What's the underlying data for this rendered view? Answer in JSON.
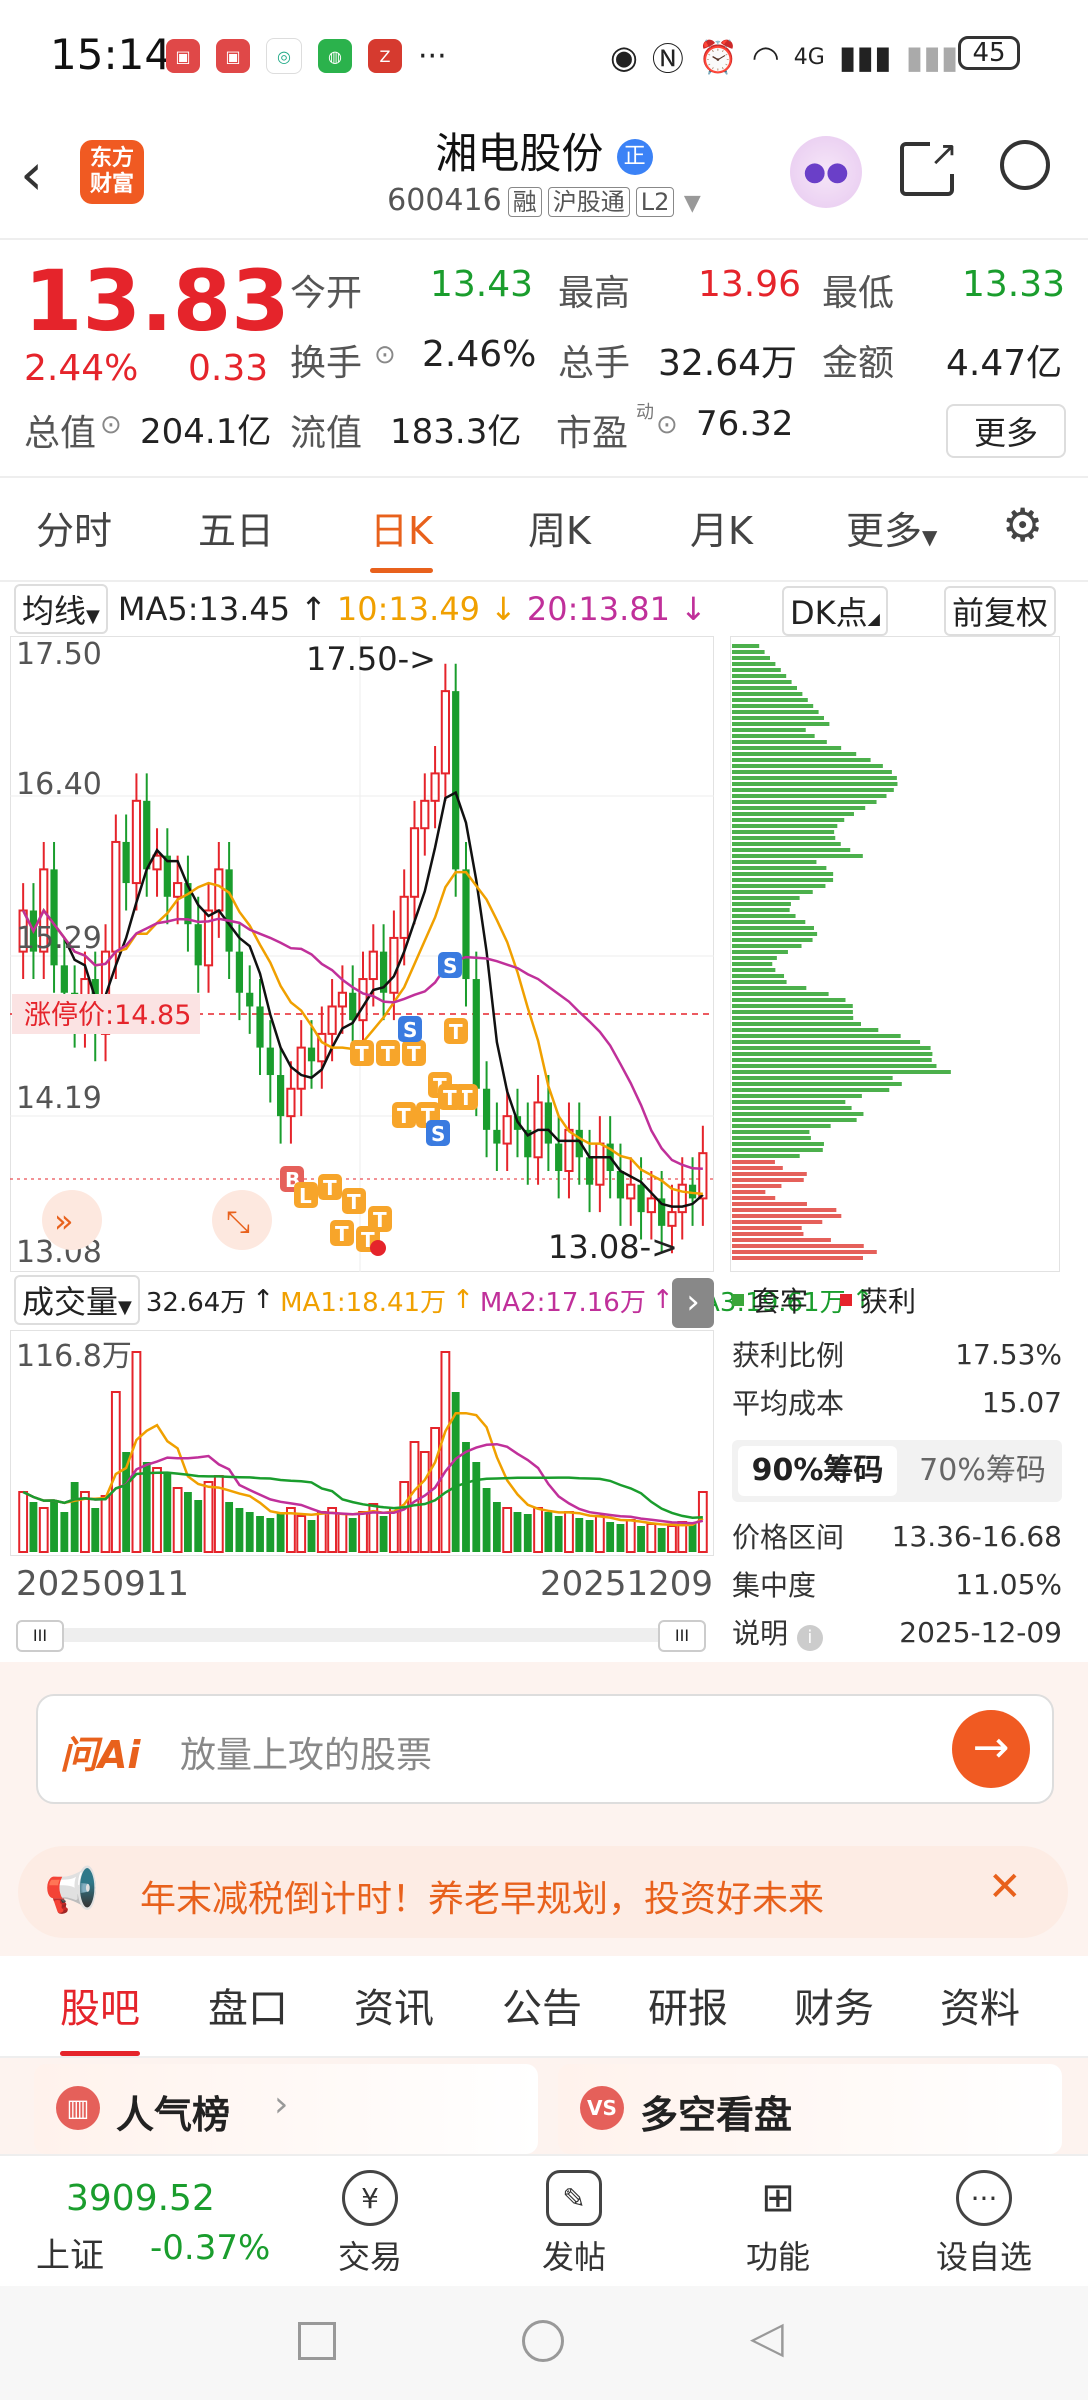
{
  "status_bar": {
    "time": "15:14",
    "notif_icons": [
      "huawei-app-icon",
      "huawei-app-icon",
      "browser-icon",
      "wechat-icon",
      "app-icon",
      "more-dots"
    ],
    "battery": "45",
    "network": "4G"
  },
  "header": {
    "logo_line1": "东方",
    "logo_line2": "财富",
    "stock_name": "湘电股份",
    "stock_badge": "正",
    "code": "600416",
    "tag_rong": "融",
    "tag_hgt": "沪股通",
    "tag_l2": "L2"
  },
  "quote": {
    "price": "13.83",
    "change_pct": "2.44%",
    "change_amt": "0.33",
    "fields": [
      {
        "label": "今开",
        "value": "13.43",
        "color": "green"
      },
      {
        "label": "最高",
        "value": "13.96",
        "color": "red"
      },
      {
        "label": "最低",
        "value": "13.33",
        "color": "green"
      },
      {
        "label": "换手",
        "value": "2.46%",
        "color": "black"
      },
      {
        "label": "总手",
        "value": "32.64万",
        "color": "black"
      },
      {
        "label": "金额",
        "value": "4.47亿",
        "color": "black"
      },
      {
        "label": "总值",
        "value": "204.1亿",
        "color": "black"
      },
      {
        "label": "流值",
        "value": "183.3亿",
        "color": "black"
      },
      {
        "label": "市盈",
        "value": "76.32",
        "color": "black"
      }
    ],
    "more_button": "更多"
  },
  "period_tabs": [
    "分时",
    "五日",
    "日K",
    "周K",
    "月K",
    "更多"
  ],
  "active_period": "日K",
  "ma_bar": {
    "selector": "均线",
    "ma5": "MA5:13.45",
    "ma10": "10:13.49",
    "ma20": "20:13.81",
    "dk_button": "DK点",
    "adjust": "前复权"
  },
  "kline": {
    "price_labels": [
      "17.50",
      "16.40",
      "15.29",
      "14.19",
      "13.08"
    ],
    "high_marker": "17.50->",
    "low_marker": "13.08->",
    "limit_up_label": "涨停价:14.85"
  },
  "volume": {
    "selector": "成交量",
    "current": "32.64万",
    "ma1": "MA1:18.41万",
    "ma2": "MA2:17.16万",
    "ma3": "MA3:19.61万",
    "max_label": "116.8万",
    "start_date": "20250911",
    "end_date": "20251209"
  },
  "chip": {
    "legend_trapped": "套牢",
    "legend_profit": "获利",
    "stats": [
      {
        "label": "获利比例",
        "value": "17.53%"
      },
      {
        "label": "平均成本",
        "value": "15.07"
      }
    ],
    "tab_90": "90%筹码",
    "tab_70": "70%筹码",
    "stats2": [
      {
        "label": "价格区间",
        "value": "13.36-16.68"
      },
      {
        "label": "集中度",
        "value": "11.05%"
      },
      {
        "label": "说明",
        "value": "2025-12-09"
      }
    ]
  },
  "ai_search": {
    "logo": "问Ai",
    "placeholder": "放量上攻的股票"
  },
  "banner_text": "年末减税倒计时！养老早规划，投资好未来",
  "section_tabs": [
    "股吧",
    "盘口",
    "资讯",
    "公告",
    "研报",
    "财务",
    "资料"
  ],
  "active_section": "股吧",
  "cards": [
    {
      "title": "人气榜",
      "icon": "chart-icon"
    },
    {
      "title": "多空看盘",
      "icon": "vs-icon"
    }
  ],
  "bottom_nav": {
    "index_value": "3909.52",
    "index_name": "上证",
    "index_change": "-0.37%",
    "items": [
      "交易",
      "发帖",
      "功能",
      "设自选"
    ]
  },
  "colors": {
    "up": "#e5242b",
    "down": "#1a9d2d",
    "accent": "#e8611c"
  }
}
